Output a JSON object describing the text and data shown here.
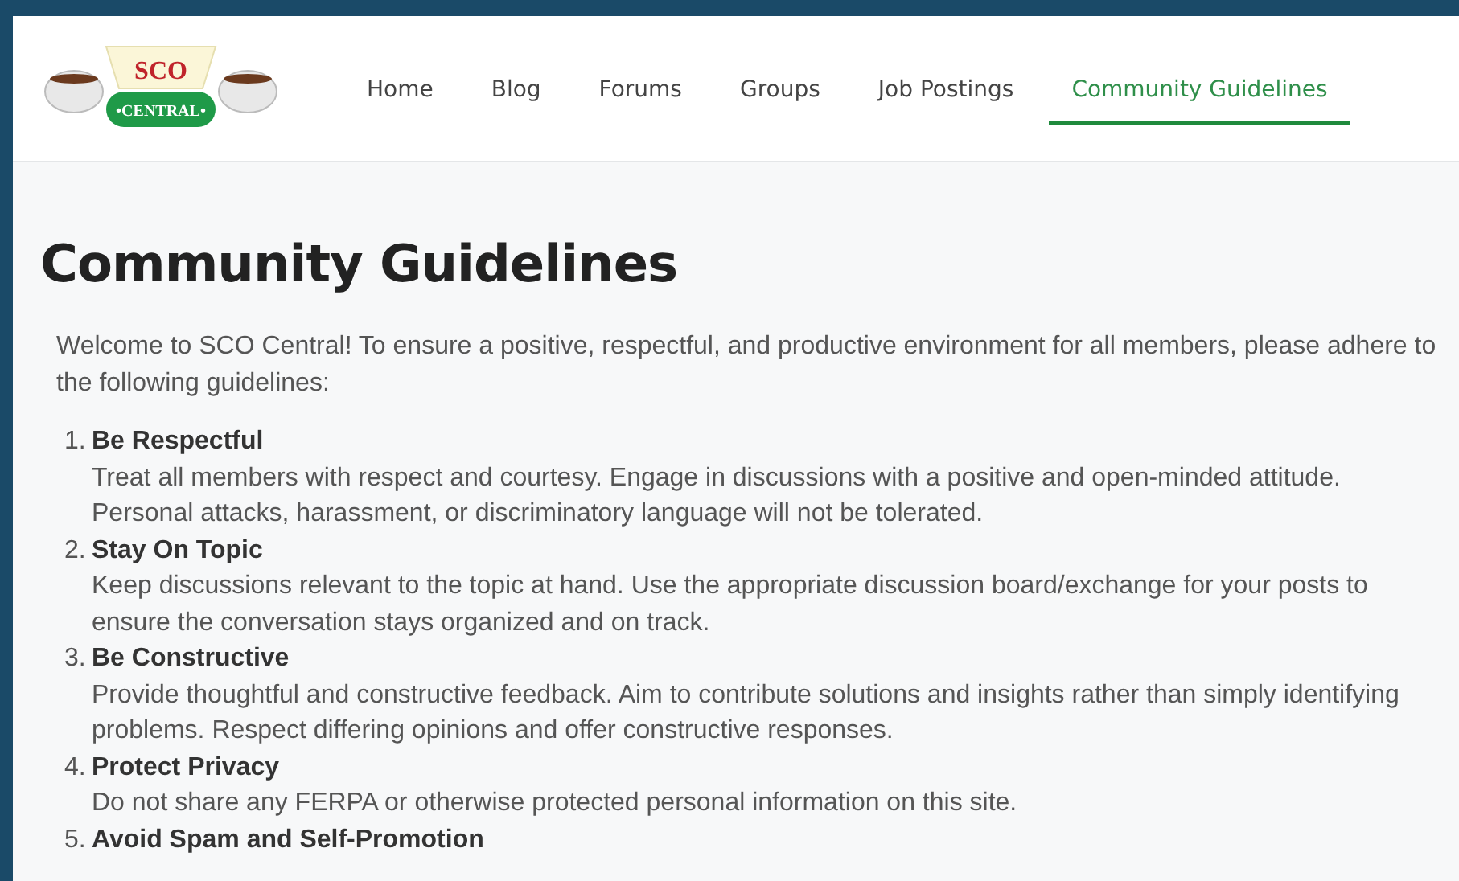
{
  "logo": {
    "top_text": "SCO",
    "bottom_text": "•CENTRAL•"
  },
  "nav": [
    {
      "label": "Home",
      "selected": false
    },
    {
      "label": "Blog",
      "selected": false
    },
    {
      "label": "Forums",
      "selected": false
    },
    {
      "label": "Groups",
      "selected": false
    },
    {
      "label": "Job Postings",
      "selected": false
    },
    {
      "label": "Community Guidelines",
      "selected": true
    }
  ],
  "page": {
    "title": "Community Guidelines",
    "intro": "Welcome to SCO Central! To ensure a positive, respectful, and productive environment for all members, please adhere to the following guidelines:",
    "guidelines": [
      {
        "number": "1.",
        "heading": "Be Respectful",
        "text": "Treat all members with respect and courtesy. Engage in discussions with a positive and open-minded attitude. Personal attacks, harassment, or discriminatory language will not be tolerated."
      },
      {
        "number": "2.",
        "heading": "Stay On Topic",
        "text": "Keep discussions relevant to the topic at hand. Use the appropriate discussion board/exchange for your posts to ensure the conversation stays organized and on track."
      },
      {
        "number": "3.",
        "heading": "Be Constructive",
        "text": "Provide thoughtful and constructive feedback. Aim to contribute solutions and insights rather than simply identifying problems. Respect differing opinions and offer constructive responses."
      },
      {
        "number": "4.",
        "heading": "Protect Privacy",
        "text": "Do not share any FERPA or otherwise protected personal information on this site."
      },
      {
        "number": "5.",
        "heading": "Avoid Spam and Self-Promotion"
      }
    ]
  }
}
